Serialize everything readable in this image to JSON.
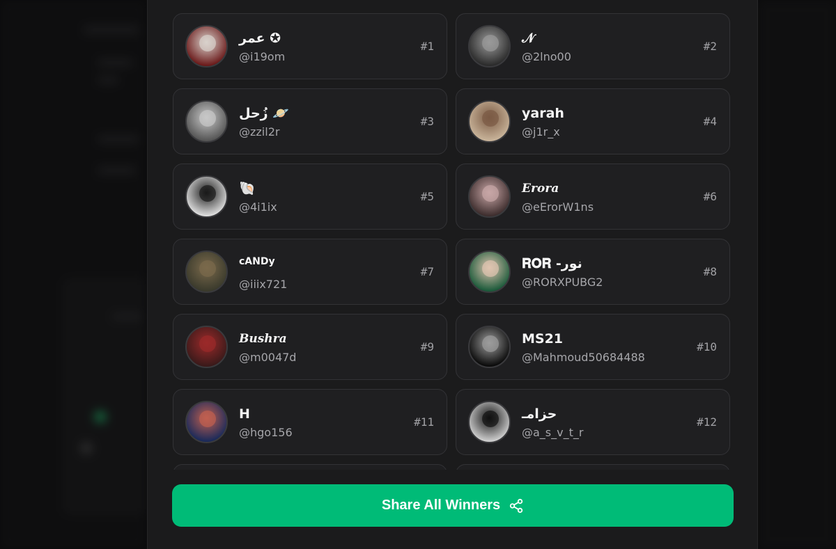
{
  "winners": [
    {
      "name": "عمر ✪",
      "handle": "@i19om",
      "rank": "#1",
      "avatar": "soccer-player-photo",
      "colors": [
        "#6b1a1a",
        "#d8d2cc"
      ]
    },
    {
      "name": "𝒩",
      "handle": "@2lno00",
      "rank": "#2",
      "avatar": "woman-portrait-bw",
      "colors": [
        "#2b2b2b",
        "#9a9a9a"
      ]
    },
    {
      "name": "زُحل 🪐",
      "handle": "@zzil2r",
      "rank": "#3",
      "avatar": "cat-closeup-bw",
      "colors": [
        "#555555",
        "#c8c8c8"
      ]
    },
    {
      "name": "yarah",
      "handle": "@j1r_x",
      "rank": "#4",
      "avatar": "girl-selfie",
      "colors": [
        "#c9b49a",
        "#7a5a44"
      ]
    },
    {
      "name": "🐚",
      "handle": "@4i1ix",
      "rank": "#5",
      "avatar": "woman-portrait-bw",
      "colors": [
        "#dedede",
        "#1a1a1a"
      ]
    },
    {
      "name": "𝑬𝒓𝒐𝒓𝒂",
      "handle": "@eErorW1ns",
      "rank": "#6",
      "avatar": "girl-with-plush",
      "colors": [
        "#3e2e2e",
        "#c8a6a6"
      ]
    },
    {
      "name": "cANDy",
      "handle": "@iiix721",
      "rank": "#7",
      "avatar": "hair-back-photo",
      "colors": [
        "#3a3a2c",
        "#7b6a4c"
      ]
    },
    {
      "name": "𝐑𝐎𝐑 -نور",
      "handle": "@RORXPUBG2",
      "rank": "#8",
      "avatar": "woman-portrait-green",
      "colors": [
        "#1b5a3a",
        "#e0c4b0"
      ]
    },
    {
      "name": "𝑩𝒖𝒔𝒉𝒓𝒂",
      "handle": "@m0047d",
      "rank": "#9",
      "avatar": "woman-red-dress",
      "colors": [
        "#3a1a1a",
        "#9b2a2a"
      ]
    },
    {
      "name": "MS21",
      "handle": "@Mahmoud50684488",
      "rank": "#10",
      "avatar": "full-moon",
      "colors": [
        "#0a0a0a",
        "#9c9c9c"
      ]
    },
    {
      "name": "H",
      "handle": "@hgo156",
      "rank": "#11",
      "avatar": "concert-performer",
      "colors": [
        "#1a2a5a",
        "#c06050"
      ]
    },
    {
      "name": "حزامـ",
      "handle": "@a_s_v_t_r",
      "rank": "#12",
      "avatar": "hat-figure-bw",
      "colors": [
        "#cfcfcf",
        "#111111"
      ]
    }
  ],
  "share": {
    "label": "Share All Winners",
    "icon": "share-icon"
  }
}
